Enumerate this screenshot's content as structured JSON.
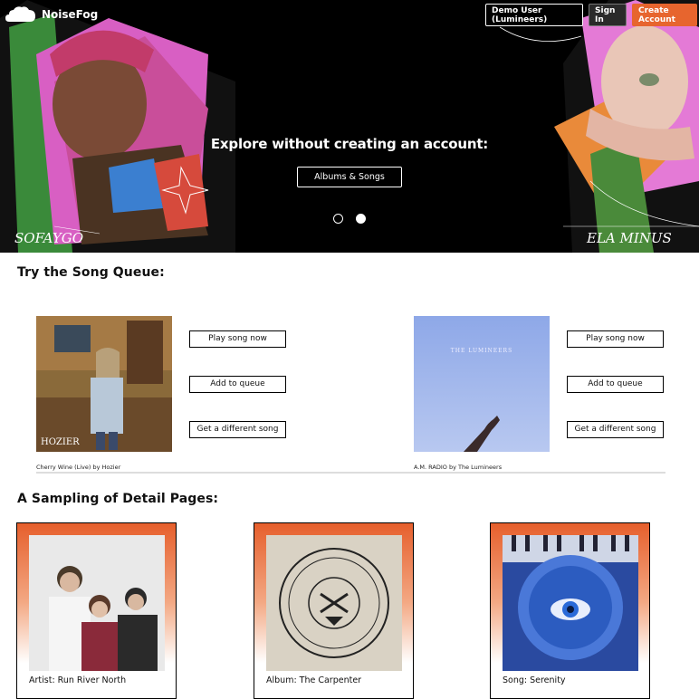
{
  "app": {
    "name": "NoiseFog"
  },
  "nav": {
    "demo_label": "Demo User (Lumineers)",
    "signin_label": "Sign In",
    "create_label": "Create Account"
  },
  "hero": {
    "title": "Explore without creating an account:",
    "button_label": "Albums & Songs",
    "left_artist_signature": "SOFAYGO",
    "right_artist_signature": "ELA MINUS",
    "carousel_active_index": 2,
    "carousel_count": 2
  },
  "queue": {
    "title": "Try the Song Queue:",
    "songs": [
      {
        "caption": "Cherry Wine (Live) by Hozier",
        "play_label": "Play song now",
        "add_label": "Add to queue",
        "different_label": "Get a different song",
        "art_text": "HOZIER"
      },
      {
        "caption": "A.M. RADIO by The Lumineers",
        "play_label": "Play song now",
        "add_label": "Add to queue",
        "different_label": "Get a different song",
        "art_text": "THE LUMINEERS"
      }
    ]
  },
  "details": {
    "title": "A Sampling of Detail Pages:",
    "cards": [
      {
        "label": "Artist: Run River North"
      },
      {
        "label": "Album: The Carpenter"
      },
      {
        "label": "Song: Serenity"
      }
    ]
  },
  "colors": {
    "accent": "#e7652e",
    "hero_bg": "#000000",
    "card_gradient_top": "#e65f2c"
  }
}
